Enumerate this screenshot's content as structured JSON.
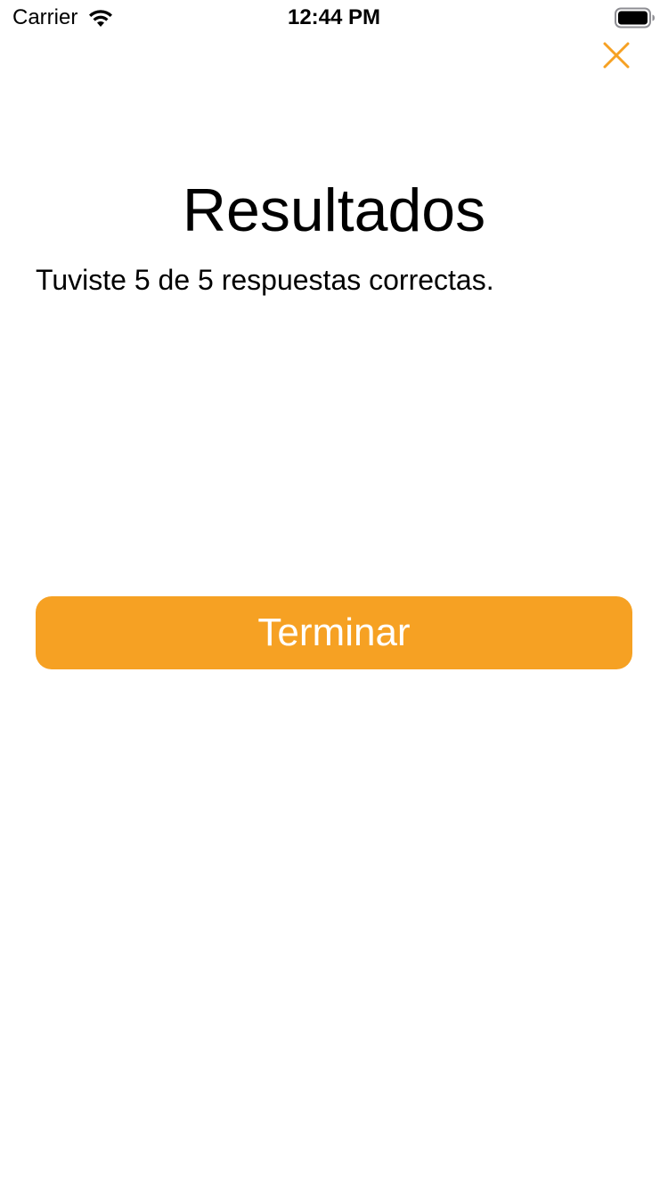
{
  "status_bar": {
    "carrier": "Carrier",
    "time": "12:44 PM",
    "wifi_icon": "wifi-icon",
    "battery_icon": "battery-icon"
  },
  "header": {
    "close_icon": "close-icon"
  },
  "main": {
    "title": "Resultados",
    "result_message": "Tuviste 5 de 5 respuestas correctas.",
    "finish_label": "Terminar"
  },
  "colors": {
    "accent": "#F6A123",
    "button_text": "#FFFFFF",
    "text": "#000000",
    "background": "#FFFFFF"
  }
}
